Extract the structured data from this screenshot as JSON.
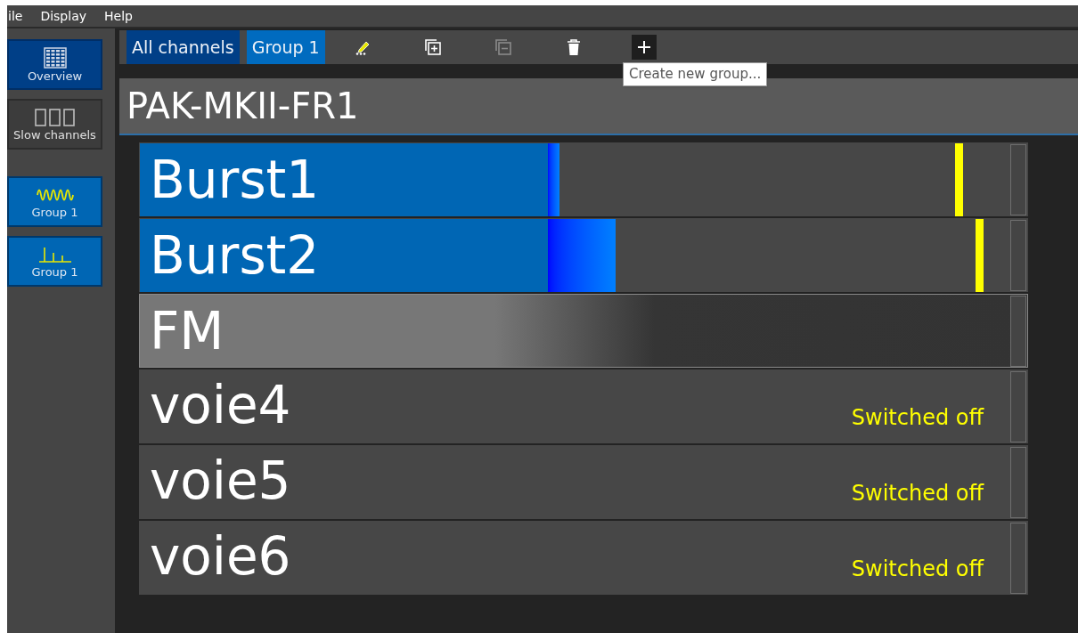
{
  "menu": [
    "ile",
    "Display",
    "Help"
  ],
  "sidebar": [
    {
      "kind": "grid",
      "label": "Overview",
      "selected": true
    },
    {
      "kind": "digits",
      "label": "Slow channels",
      "selected": false
    },
    {
      "kind": "wave",
      "label": "Group 1",
      "selected": false
    },
    {
      "kind": "spikes",
      "label": "Group 1",
      "selected": false
    }
  ],
  "tabs": [
    {
      "label": "All channels",
      "selected": true
    },
    {
      "label": "Group 1",
      "selected": false
    }
  ],
  "toolbar": [
    {
      "kind": "edit",
      "disabled": false,
      "hovered": false
    },
    {
      "kind": "add-copy",
      "disabled": false,
      "hovered": false
    },
    {
      "kind": "remove-copy",
      "disabled": true,
      "hovered": false
    },
    {
      "kind": "delete",
      "disabled": false,
      "hovered": false
    },
    {
      "kind": "plus",
      "disabled": false,
      "hovered": true
    }
  ],
  "tooltip": "Create new group...",
  "title": "PAK-MKII-FR1",
  "channels": [
    {
      "name": "Burst1",
      "kind": "meter",
      "selected": false,
      "level": 0.025,
      "peak": {
        "level": 0.88
      }
    },
    {
      "name": "Burst2",
      "kind": "meter",
      "selected": false,
      "level": 0.146,
      "peak": {
        "level": 0.925
      }
    },
    {
      "name": "FM",
      "kind": "idle",
      "selected": true
    },
    {
      "name": "voie4",
      "kind": "off",
      "selected": false,
      "status": "Switched off"
    },
    {
      "name": "voie5",
      "kind": "off",
      "selected": false,
      "status": "Switched off"
    },
    {
      "name": "voie6",
      "kind": "off",
      "selected": false,
      "status": "Switched off"
    }
  ]
}
